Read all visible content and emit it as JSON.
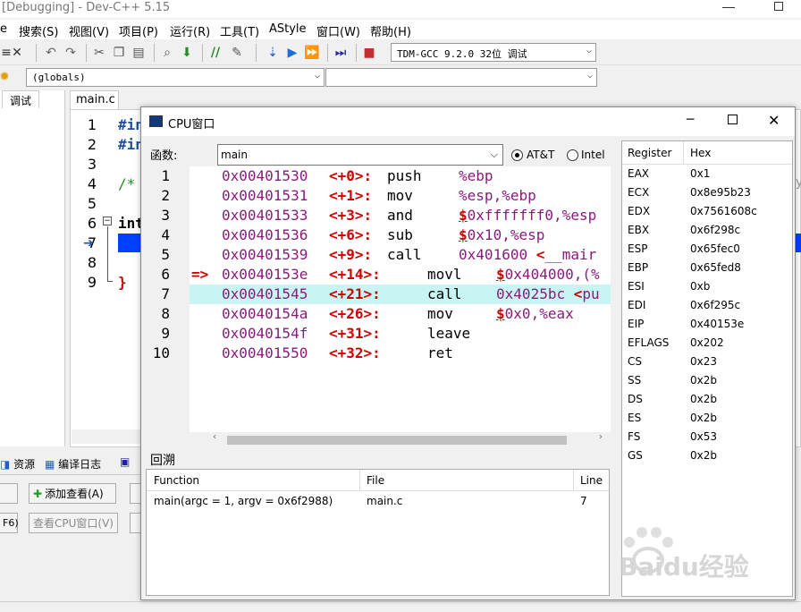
{
  "window": {
    "title": "[Debugging] - Dev-C++ 5.15"
  },
  "menu": [
    "搜索(S)",
    "视图(V)",
    "项目(P)",
    "运行(R)",
    "工具(T)",
    "AStyle",
    "窗口(W)",
    "帮助(H)"
  ],
  "menu_partial": "e",
  "toolbar": {
    "compiler": "TDM-GCC 9.2.0 32位 调试"
  },
  "toolbar2": {
    "scope": "(globals)"
  },
  "left_tabs": {
    "debug": "调试"
  },
  "editor": {
    "tab": "main.c",
    "line_numbers": [
      "1",
      "2",
      "3",
      "4",
      "5",
      "6",
      "7",
      "8",
      "9"
    ],
    "lines": [
      "#in",
      "#in",
      "",
      "/*",
      "",
      "int",
      "",
      "",
      "}"
    ]
  },
  "bottom_panel": {
    "tabs": [
      "资源",
      "编译日志"
    ],
    "add_watch": "添加查看(A)",
    "view_cpu": "查看CPU窗口(V)",
    "f6": "F6)"
  },
  "cpu": {
    "title": "CPU窗口",
    "function_label": "函数:",
    "function_value": "main",
    "syntax_att": "AT&T",
    "syntax_intel": "Intel",
    "asm": [
      {
        "n": "1",
        "addr": "0x00401530",
        "off": "<+0>:",
        "ins": "push",
        "opr": "%ebp",
        "arrow": "",
        "hl": false,
        "indent": false
      },
      {
        "n": "2",
        "addr": "0x00401531",
        "off": "<+1>:",
        "ins": "mov",
        "opr": "%esp,%ebp",
        "arrow": "",
        "hl": false,
        "indent": false
      },
      {
        "n": "3",
        "addr": "0x00401533",
        "off": "<+3>:",
        "ins": "and",
        "opr": "$0xfffffff0,%esp",
        "arrow": "",
        "hl": false,
        "indent": false
      },
      {
        "n": "4",
        "addr": "0x00401536",
        "off": "<+6>:",
        "ins": "sub",
        "opr": "$0x10,%esp",
        "arrow": "",
        "hl": false,
        "indent": false
      },
      {
        "n": "5",
        "addr": "0x00401539",
        "off": "<+9>:",
        "ins": "call",
        "opr": "0x401600 <__mair",
        "arrow": "",
        "hl": false,
        "indent": false
      },
      {
        "n": "6",
        "addr": "0x0040153e",
        "off": "<+14>:",
        "ins": "movl",
        "opr": "$0x404000,(%",
        "arrow": "=>",
        "hl": false,
        "indent": true
      },
      {
        "n": "7",
        "addr": "0x00401545",
        "off": "<+21>:",
        "ins": "call",
        "opr": "0x4025bc <pu",
        "arrow": "",
        "hl": true,
        "indent": true
      },
      {
        "n": "8",
        "addr": "0x0040154a",
        "off": "<+26>:",
        "ins": "mov",
        "opr": "$0x0,%eax",
        "arrow": "",
        "hl": false,
        "indent": true
      },
      {
        "n": "9",
        "addr": "0x0040154f",
        "off": "<+31>:",
        "ins": "leave",
        "opr": "",
        "arrow": "",
        "hl": false,
        "indent": true
      },
      {
        "n": "10",
        "addr": "0x00401550",
        "off": "<+32>:",
        "ins": "ret",
        "opr": "",
        "arrow": "",
        "hl": false,
        "indent": true
      }
    ],
    "registers_header": {
      "reg": "Register",
      "hex": "Hex"
    },
    "registers": [
      {
        "r": "EAX",
        "v": "0x1"
      },
      {
        "r": "ECX",
        "v": "0x8e95b23"
      },
      {
        "r": "EDX",
        "v": "0x7561608c"
      },
      {
        "r": "EBX",
        "v": "0x6f298c"
      },
      {
        "r": "ESP",
        "v": "0x65fec0"
      },
      {
        "r": "EBP",
        "v": "0x65fed8"
      },
      {
        "r": "ESI",
        "v": "0xb"
      },
      {
        "r": "EDI",
        "v": "0x6f295c"
      },
      {
        "r": "EIP",
        "v": "0x40153e"
      },
      {
        "r": "EFLAGS",
        "v": "0x202"
      },
      {
        "r": "CS",
        "v": "0x23"
      },
      {
        "r": "SS",
        "v": "0x2b"
      },
      {
        "r": "DS",
        "v": "0x2b"
      },
      {
        "r": "ES",
        "v": "0x2b"
      },
      {
        "r": "FS",
        "v": "0x53"
      },
      {
        "r": "GS",
        "v": "0x2b"
      }
    ],
    "backtrace_label": "回溯",
    "backtrace_headers": {
      "function": "Function",
      "file": "File",
      "line": "Line"
    },
    "backtrace_rows": [
      {
        "function": "main(argc = 1, argv = 0x6f2988)",
        "file": "main.c",
        "line": "7"
      }
    ]
  },
  "watermark": "Baidu经验"
}
